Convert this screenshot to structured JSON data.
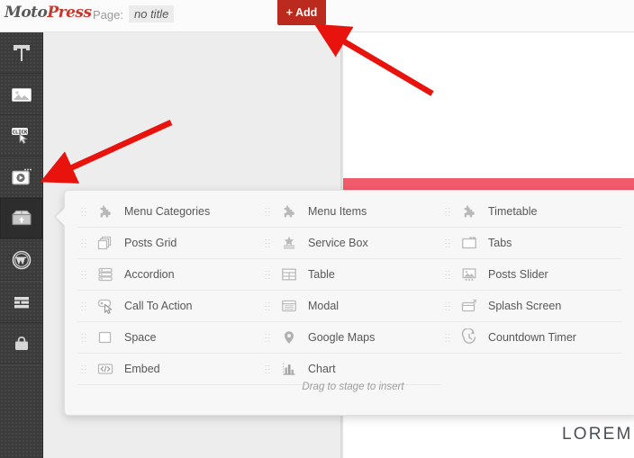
{
  "topbar": {
    "logo_moto": "Moto",
    "logo_press": "Press",
    "page_label": "Page:",
    "page_title": "no title",
    "add_button": "+ Add",
    "add_button_color": "#bc2a1d"
  },
  "sidebar": {
    "items": [
      {
        "name": "text-tool",
        "icon": "text-t-icon",
        "active": false
      },
      {
        "name": "image-tool",
        "icon": "image-icon",
        "active": false
      },
      {
        "name": "button-tool",
        "icon": "click-button-icon",
        "label": "CLICK",
        "active": false
      },
      {
        "name": "video-tool",
        "icon": "video-player-icon",
        "active": false
      },
      {
        "name": "addons-tool",
        "icon": "package-box-icon",
        "active": true
      },
      {
        "name": "wordpress-tool",
        "icon": "wordpress-icon",
        "active": false
      },
      {
        "name": "rows-tool",
        "icon": "rows-list-icon",
        "active": false
      },
      {
        "name": "shop-tool",
        "icon": "shop-bag-icon",
        "active": false
      }
    ]
  },
  "panel": {
    "drag_hint": "Drag to stage to insert",
    "columns": [
      {
        "items": [
          {
            "label": "Menu Categories",
            "icon": "puzzle-icon"
          },
          {
            "label": "Posts Grid",
            "icon": "stacked-squares-icon"
          },
          {
            "label": "Accordion",
            "icon": "accordion-stack-icon"
          },
          {
            "label": "Call To Action",
            "icon": "cursor-banner-icon"
          },
          {
            "label": "Space",
            "icon": "empty-square-icon"
          },
          {
            "label": "Embed",
            "icon": "code-brackets-icon"
          }
        ]
      },
      {
        "items": [
          {
            "label": "Menu Items",
            "icon": "puzzle-icon"
          },
          {
            "label": "Service Box",
            "icon": "star-lines-icon"
          },
          {
            "label": "Table",
            "icon": "table-grid-icon"
          },
          {
            "label": "Modal",
            "icon": "modal-window-icon"
          },
          {
            "label": "Google Maps",
            "icon": "map-pin-icon"
          },
          {
            "label": "Chart",
            "icon": "bar-chart-icon"
          }
        ]
      },
      {
        "items": [
          {
            "label": "Timetable",
            "icon": "puzzle-icon"
          },
          {
            "label": "Tabs",
            "icon": "tabs-window-icon"
          },
          {
            "label": "Posts Slider",
            "icon": "image-slider-icon"
          },
          {
            "label": "Splash Screen",
            "icon": "splash-close-icon"
          },
          {
            "label": "Countdown Timer",
            "icon": "clock-timer-icon"
          }
        ]
      }
    ]
  },
  "canvas": {
    "heading_text": "LOREM I",
    "band_color": "#f05a6a"
  },
  "annotations": {
    "arrow_color": "#e8130c",
    "arrows": [
      {
        "name": "arrow-to-add-button"
      },
      {
        "name": "arrow-to-addons-sidebar"
      }
    ]
  }
}
